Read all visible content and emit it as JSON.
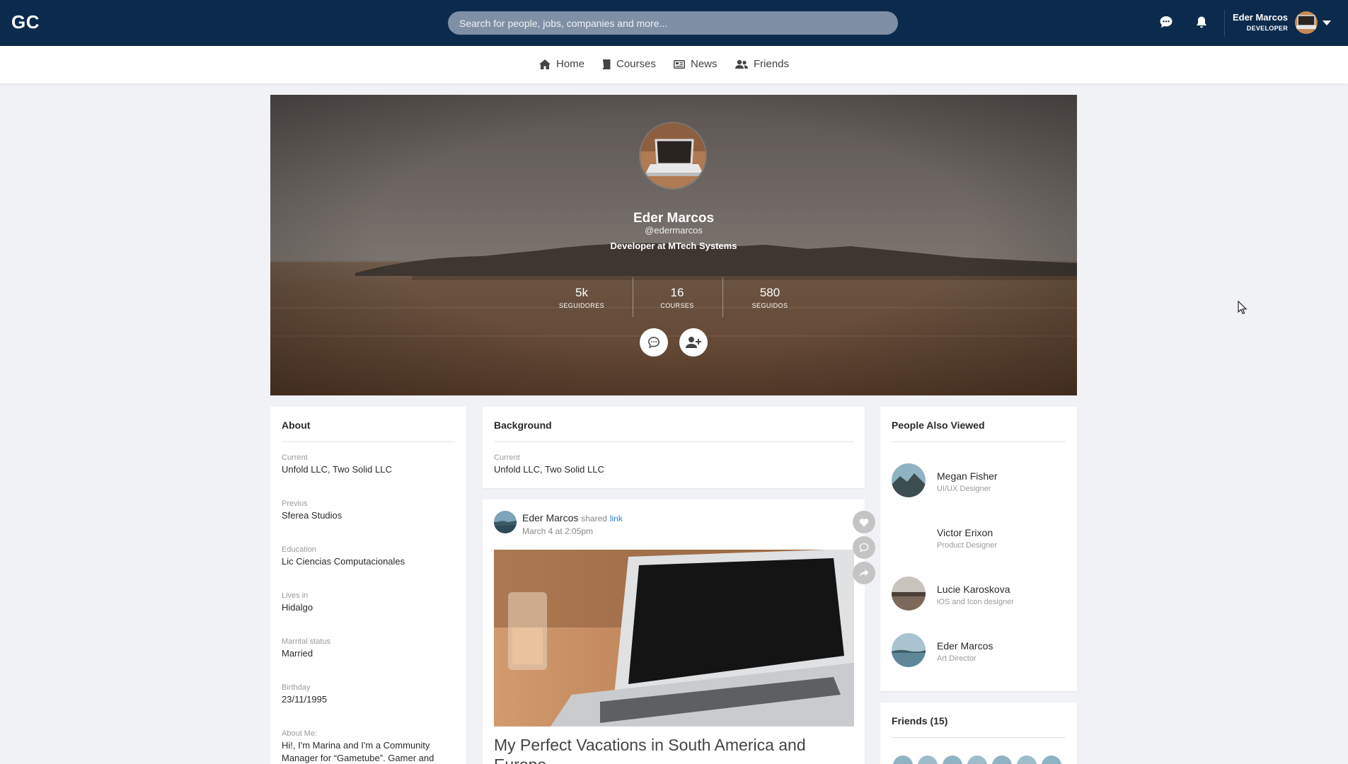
{
  "app": {
    "logo": "GC"
  },
  "search": {
    "placeholder": "Search for people, jobs, companies and more..."
  },
  "user": {
    "name": "Eder Marcos",
    "role": "DEVELOPER"
  },
  "nav": {
    "items": [
      {
        "label": "Home",
        "icon": "home-icon"
      },
      {
        "label": "Courses",
        "icon": "book-icon"
      },
      {
        "label": "News",
        "icon": "newspaper-icon"
      },
      {
        "label": "Friends",
        "icon": "users-icon"
      }
    ]
  },
  "profile": {
    "name": "Eder Marcos",
    "handle": "@edermarcos",
    "title": "Developer at MTech Systems",
    "stats": [
      {
        "value": "5k",
        "label": "SEGUIDORES"
      },
      {
        "value": "16",
        "label": "COURSES"
      },
      {
        "value": "580",
        "label": "SEGUIDOS"
      }
    ]
  },
  "about": {
    "title": "About",
    "fields": [
      {
        "label": "Current",
        "value": "Unfold LLC, Two Solid LLC"
      },
      {
        "label": "Previus",
        "value": "Sferea Studios"
      },
      {
        "label": "Education",
        "value": "Lic Ciencias Computacionales"
      },
      {
        "label": "Lives in",
        "value": "Hidalgo"
      },
      {
        "label": "Marrital status",
        "value": "Married"
      },
      {
        "label": "Birthday",
        "value": "23/11/1995"
      },
      {
        "label": "About Me:",
        "value": "Hi!, I'm Marina and I'm a Community Manager for “Gametube”. Gamer and"
      }
    ]
  },
  "background": {
    "title": "Background",
    "current_label": "Current",
    "current_value": "Unfold LLC, Two Solid LLC"
  },
  "post": {
    "author": "Eder Marcos",
    "action": "shared",
    "link_text": "link",
    "date": "March 4 at 2:05pm",
    "title": "My Perfect Vacations in South America and Europe"
  },
  "people_also_viewed": {
    "title": "People Also Viewed",
    "people": [
      {
        "name": "Megan Fisher",
        "role": "UI/UX Designer"
      },
      {
        "name": "Victor Erixon",
        "role": "Product Designer"
      },
      {
        "name": "Lucie Karoskova",
        "role": "iOS and Icon designer"
      },
      {
        "name": "Eder Marcos",
        "role": "Art Director"
      }
    ]
  },
  "friends": {
    "title": "Friends (15)"
  }
}
